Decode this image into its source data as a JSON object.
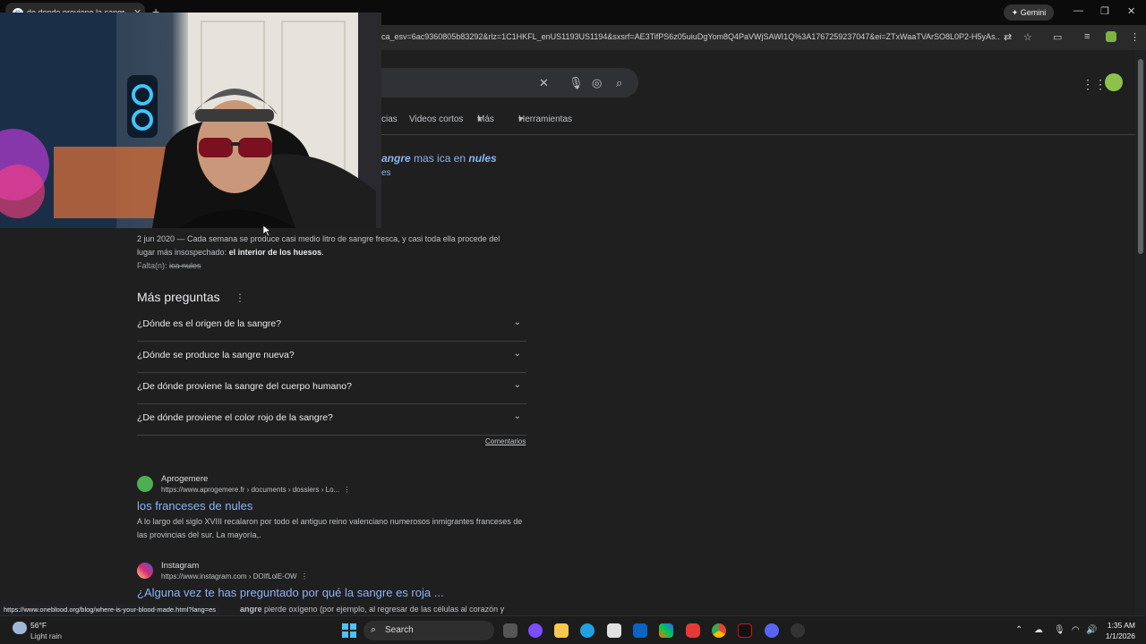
{
  "browser": {
    "tab_title": "de donde proviene la sangre mas",
    "new_tab": "+",
    "gemini_label": "Gemini",
    "url": "ca_esv=6ac9360805b83292&rlz=1C1HKFL_enUS1193US1194&sxsrf=AE3TifPS6z05uiuDgYom8Q4PaVWjSAWI1Q%3A1767259237047&ei=ZTxWaaTVArSO8L0P2-H5yAs..."
  },
  "search": {
    "tabs": [
      "cias",
      "Videos cortos",
      "Más",
      "Herramientas"
    ]
  },
  "top_snippet": {
    "part1": "angre",
    "part2": " mas ica en ",
    "part3": "nules",
    "line2": "es"
  },
  "first_result": {
    "date": "2 jun 2020",
    "text_line1": " — Cada semana se produce casi medio litro de sangre fresca, y casi toda ella procede del",
    "text_line2_prefix": "lugar más insospechado: ",
    "text_line2_bold": "el interior de los huesos",
    "text_line2_suffix": ".",
    "missing_label": "Falta(n): ",
    "missing_terms": "ica nules"
  },
  "more_questions": {
    "title": "Más preguntas",
    "items": [
      "¿Dónde es el origen de la sangre?",
      "¿Dónde se produce la sangre nueva?",
      "¿De dónde proviene la sangre del cuerpo humano?",
      "¿De dónde proviene el color rojo de la sangre?"
    ],
    "feedback": "Comentarios"
  },
  "results": [
    {
      "site": "Aprogemere",
      "url": "https://www.aprogemere.fr › documents › dossiers › Lo...",
      "title": "los franceses de nules",
      "snippet": "A lo largo del siglo XVIII recalaron por todo el antiguo reino valenciano numerosos inmigrantes franceses de las provincias del sur. La mayoría,."
    },
    {
      "site": "Instagram",
      "url": "https://www.instagram.com › DOIfLolE-OW",
      "title": "¿Alguna vez te has preguntado por qué la sangre es roja ...",
      "snippet_bold": "angre",
      "snippet_rest": " pierde oxígeno (por ejemplo, al regresar de las células al corazón y"
    }
  ],
  "status_url": "https://www.oneblood.org/blog/where-is-your-blood-made.html?lang=es",
  "taskbar": {
    "weather_temp": "56°F",
    "weather_desc": "Light rain",
    "search_label": "Search",
    "time": "1:35 AM",
    "date": "1/1/2026"
  },
  "colors": {
    "link": "#8ab4f8",
    "background": "#1f1f1f",
    "text": "#e8eaed"
  }
}
